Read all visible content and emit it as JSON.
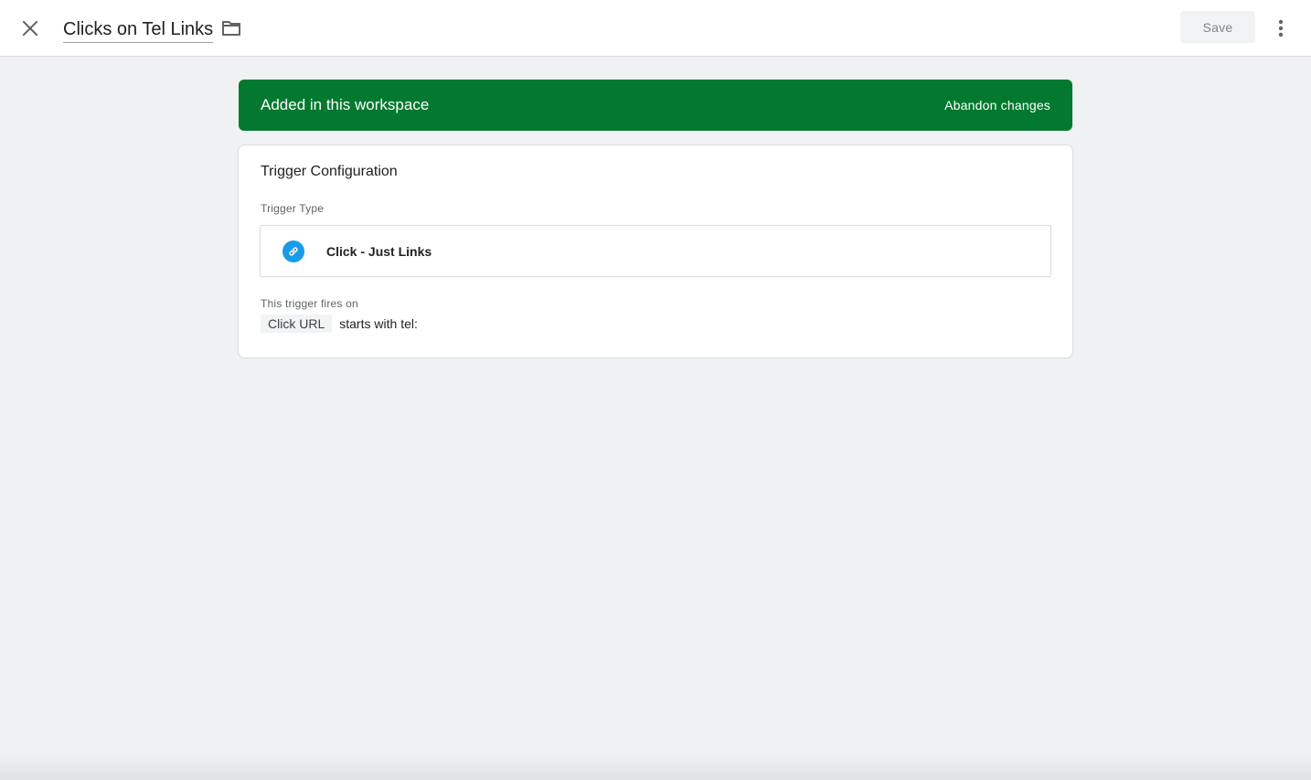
{
  "header": {
    "title": "Clicks on Tel Links",
    "save_label": "Save",
    "icons": {
      "close": "close-icon",
      "folder": "folder-icon",
      "more": "more-vert-icon"
    }
  },
  "banner": {
    "message": "Added in this workspace",
    "action_label": "Abandon changes",
    "color": "#02792f"
  },
  "config": {
    "title": "Trigger Configuration",
    "type_label": "Trigger Type",
    "type_value": "Click - Just Links",
    "type_icon": "link-icon",
    "type_icon_color": "#1a9be8",
    "fires_label": "This trigger fires on",
    "condition": {
      "variable": "Click URL",
      "operator": "starts with",
      "value": "tel:"
    }
  }
}
